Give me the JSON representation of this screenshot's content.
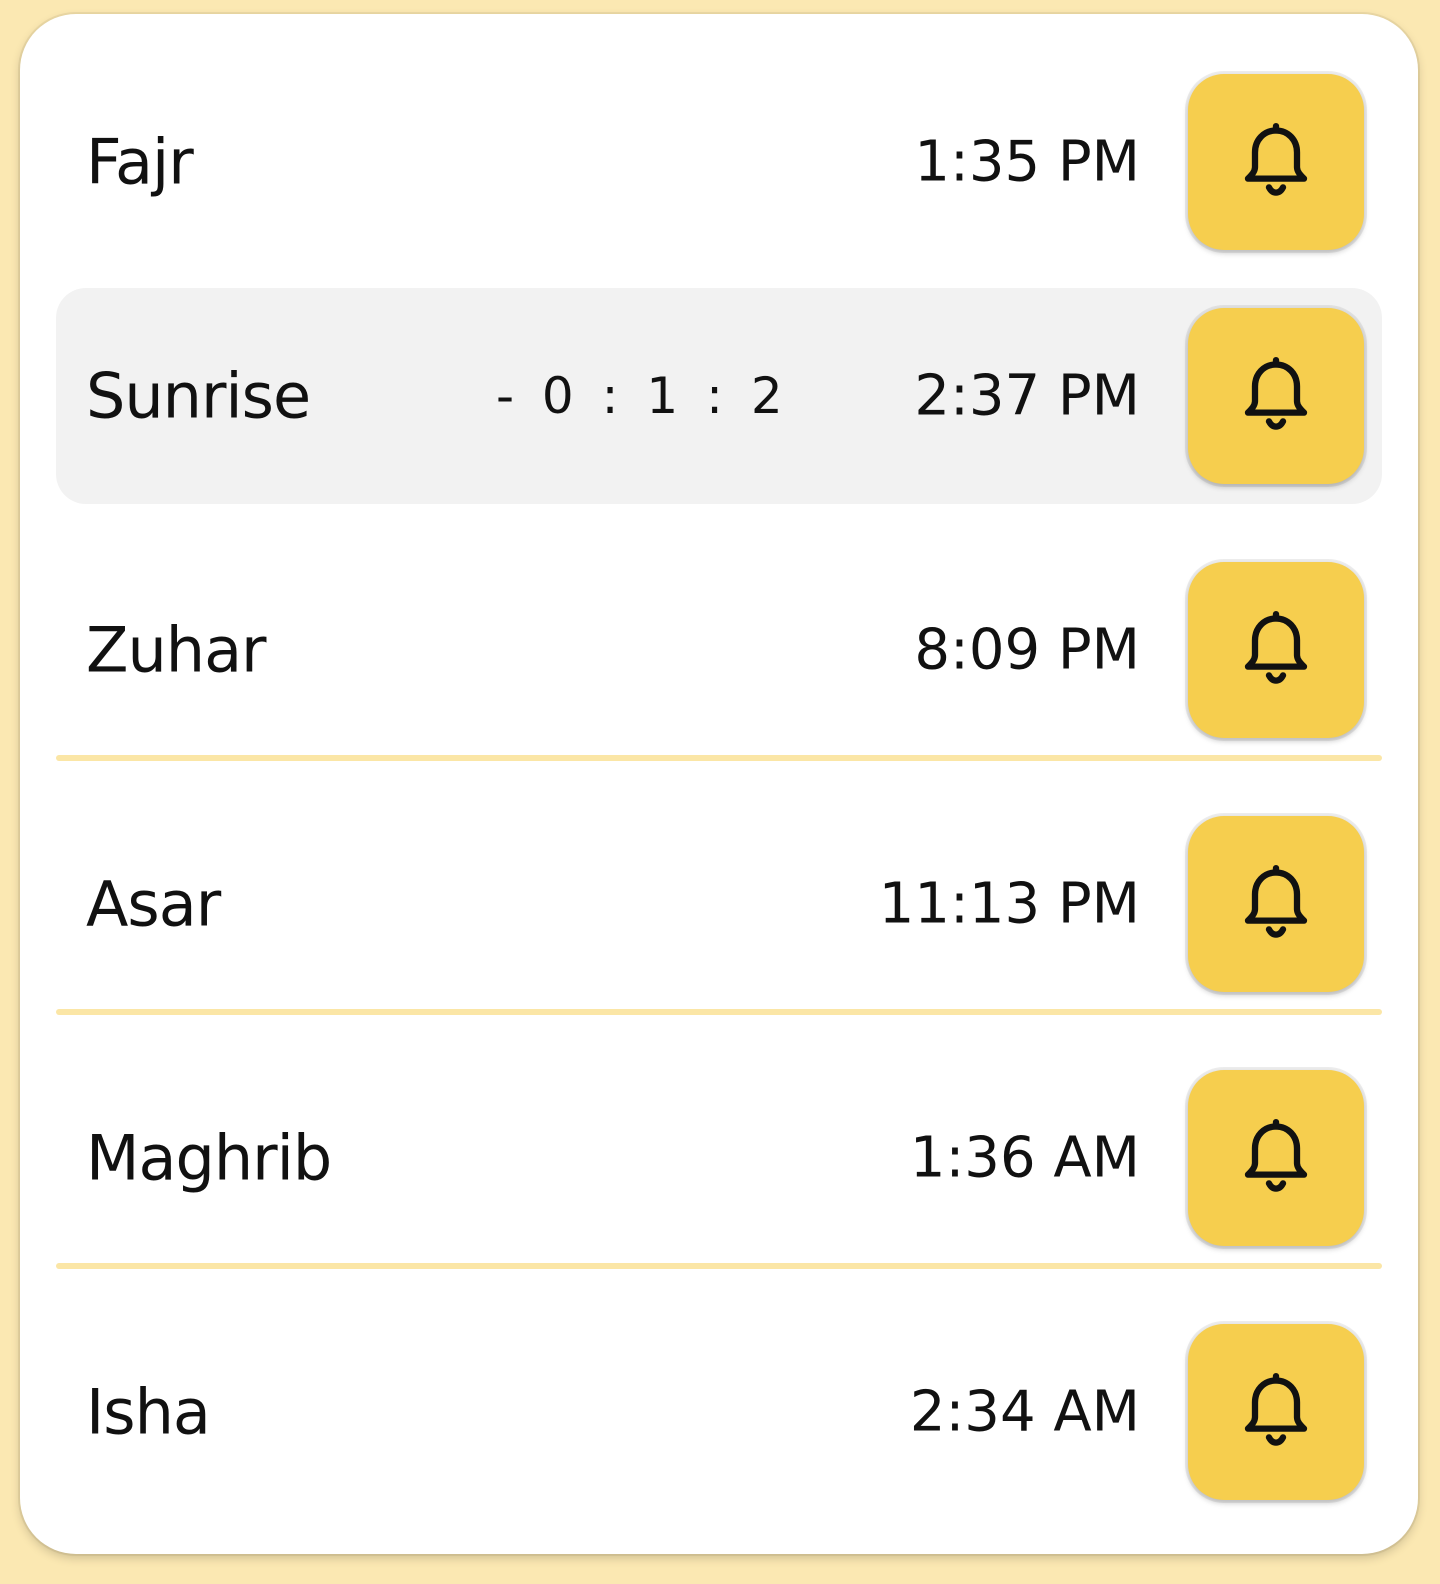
{
  "theme": {
    "background": "#fbe8b2",
    "card": "#ffffff",
    "accent": "#f6ce4e",
    "divider": "#fbe6a6",
    "current_row": "#f2f2f2"
  },
  "prayers": [
    {
      "name": "Fajr",
      "time": "1:35 PM",
      "countdown": "",
      "icon": "bell-icon"
    },
    {
      "name": "Sunrise",
      "time": "2:37 PM",
      "countdown": "- 0 : 1 : 2",
      "icon": "bell-icon",
      "current": true
    },
    {
      "name": "Zuhar",
      "time": "8:09 PM",
      "countdown": "",
      "icon": "bell-icon"
    },
    {
      "name": "Asar",
      "time": "11:13 PM",
      "countdown": "",
      "icon": "bell-icon"
    },
    {
      "name": "Maghrib",
      "time": "1:36 AM",
      "countdown": "",
      "icon": "bell-icon"
    },
    {
      "name": "Isha",
      "time": "2:34 AM",
      "countdown": "",
      "icon": "bell-icon"
    }
  ]
}
